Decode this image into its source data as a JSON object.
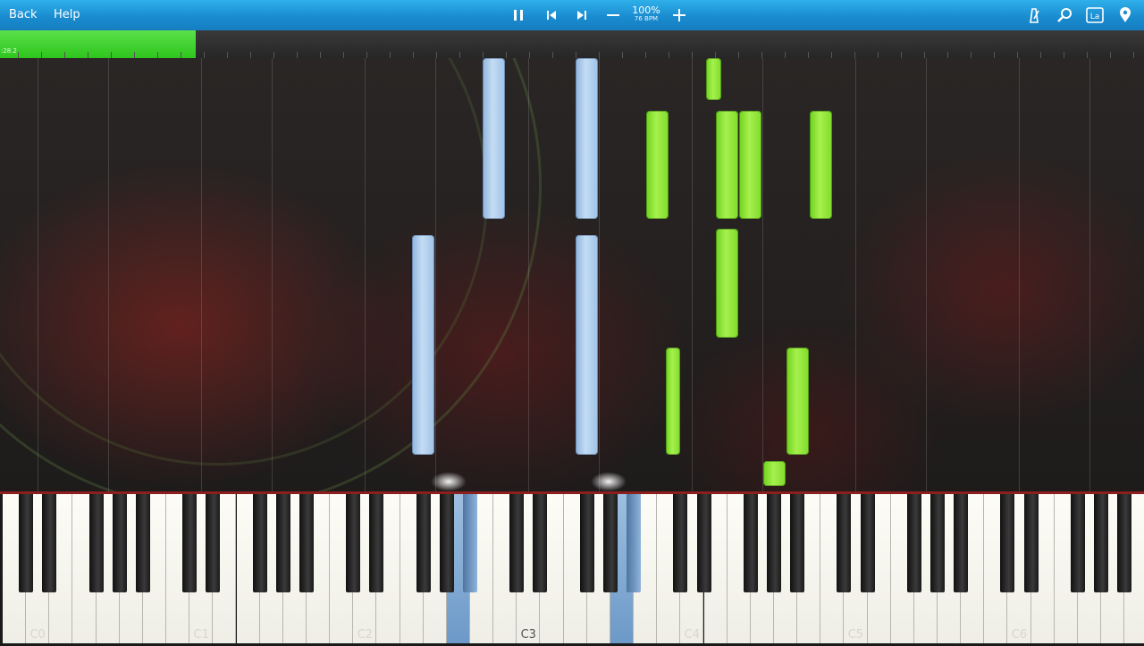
{
  "toolbar": {
    "back_label": "Back",
    "help_label": "Help",
    "tempo_percent": "100%",
    "tempo_bpm": "76 BPM",
    "icons": [
      "pause-icon",
      "previous-icon",
      "next-icon",
      "minus-icon",
      "plus-icon",
      "metronome-icon",
      "search-icon",
      "label-icon",
      "location-pin-icon"
    ],
    "label_badge": "La"
  },
  "progress": {
    "time_text": ":28.2",
    "fraction": 0.171,
    "fill_color": "#3ad42a"
  },
  "keyboard": {
    "octave_labels": [
      "C0",
      "C1",
      "C2",
      "C3",
      "C4",
      "C5",
      "C6"
    ],
    "highlighted_label": "C3"
  },
  "colors": {
    "left_hand_notes": "#b5d2f0",
    "right_hand_notes": "#8fe03a",
    "toolbar": "#1f98da",
    "keyboard_border": "#8d1f1f"
  }
}
